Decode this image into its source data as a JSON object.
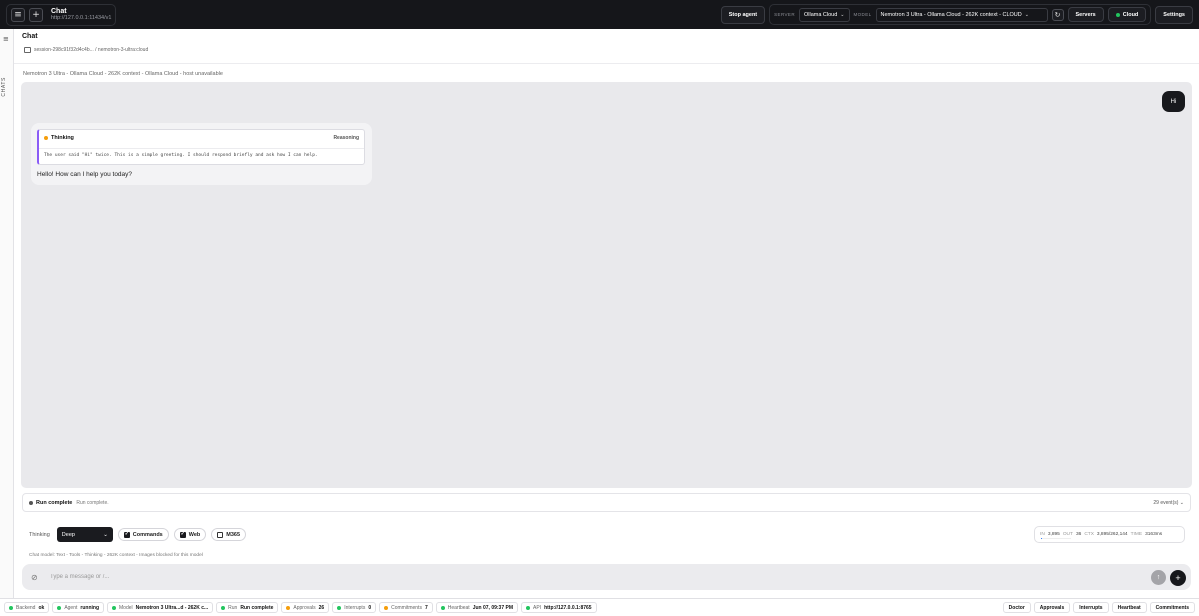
{
  "header": {
    "title": "Chat",
    "url": "http://127.0.0.1:11434/v1",
    "stop_label": "Stop agent",
    "server_label": "SERVER",
    "server_value": "Ollama Cloud",
    "model_label": "MODEL",
    "model_value": "Nemotron 3 Ultra - Ollama Cloud - 262K context - CLOUD",
    "servers_label": "Servers",
    "cloud_label": "Cloud",
    "settings_label": "Settings"
  },
  "rail": {
    "label": "CHATS"
  },
  "chat": {
    "title": "Chat",
    "breadcrumb": "session-298c91f32d4c4b... / nemotron-3-ultra:cloud",
    "model_line": "Nemotron 3 Ultra - Ollama Cloud - 262K context - Ollama Cloud - host unavailable"
  },
  "messages": {
    "user": "Hi",
    "thinking_title": "Thinking",
    "thinking_tag": "Reasoning",
    "thinking_text": "The user said \"Hi\" twice. This is a simple greeting. I should respond briefly and ask how I can help.",
    "reply": "Hello! How can I help you today?"
  },
  "run": {
    "status": "Run complete",
    "sub": "Run complete.",
    "events": "29 event(s)"
  },
  "controls": {
    "thinking_label": "Thinking",
    "thinking_value": "Deep",
    "commands": "Commands",
    "web": "Web",
    "m365": "M365",
    "capabilities": "Chat model: Text - Tools - Thinking - 262K context - Images blocked for this model"
  },
  "stats": {
    "in_label": "IN",
    "in_value": "3,895",
    "out_label": "OUT",
    "out_value": "36",
    "ctx_label": "CTX",
    "ctx_value": "3,895/262,144",
    "time_label": "TIME",
    "time_value": "3163ms"
  },
  "input": {
    "placeholder": "Type a message or /..."
  },
  "footer": {
    "backend_k": "Backend",
    "backend_v": "ok",
    "agent_k": "Agent",
    "agent_v": "running",
    "model_k": "Model",
    "model_v": "Nemotron 3 Ultra...d - 262K c...",
    "run_k": "Run",
    "run_v": "Run complete",
    "approvals_k": "Approvals",
    "approvals_v": "26",
    "interrupts_k": "Interrupts",
    "interrupts_v": "0",
    "commitments_k": "Commitments",
    "commitments_v": "7",
    "heartbeat_k": "Heartbeat",
    "heartbeat_v": "Jun 07, 09:37 PM",
    "api_k": "API",
    "api_v": "http://127.0.0.1:8765",
    "btn_doctor": "Doctor",
    "btn_approvals": "Approvals",
    "btn_interrupts": "Interrupts",
    "btn_heartbeat": "Heartbeat",
    "btn_commitments": "Commitments"
  },
  "colors": {
    "topbar": "#15161a",
    "status_green": "#22c55e",
    "status_orange": "#f59e0b",
    "thinking_accent": "#8b5cf6"
  }
}
